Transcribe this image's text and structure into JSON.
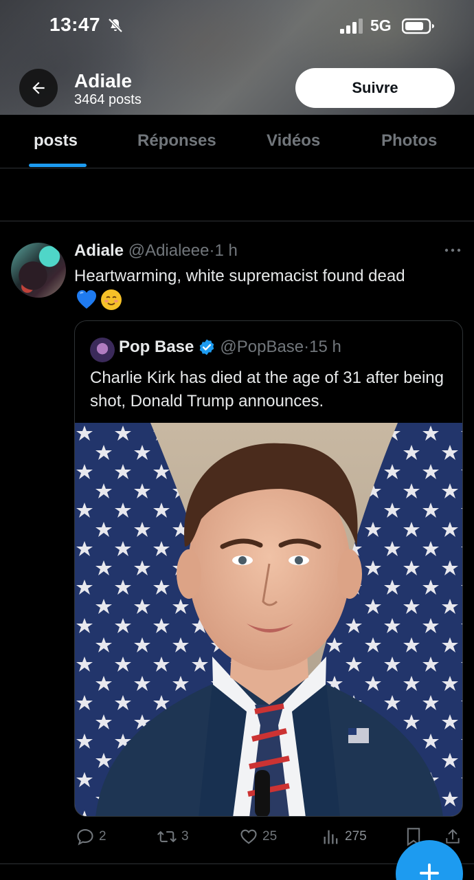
{
  "status_bar": {
    "time": "13:47",
    "network": "5G",
    "icons": [
      "bell-slash-icon",
      "signal-icon",
      "battery-icon"
    ]
  },
  "profile": {
    "name": "Adiale",
    "post_count": "3464 posts",
    "follow_label": "Suivre"
  },
  "tabs": [
    {
      "label": "posts",
      "active": true
    },
    {
      "label": "Réponses",
      "active": false
    },
    {
      "label": "Vidéos",
      "active": false
    },
    {
      "label": "Photos",
      "active": false
    }
  ],
  "tweet": {
    "author_name": "Adiale",
    "author_handle": "@Adialeee",
    "separator": "·",
    "time": "1 h",
    "text": "Heartwarming, white supremacist found dead",
    "emojis": [
      "blue-heart-emoji",
      "smiling-face-emoji"
    ],
    "quoted": {
      "author_name": "Pop Base",
      "verified": true,
      "author_handle": "@PopBase",
      "separator": "·",
      "time": "15 h",
      "text": "Charlie Kirk has died at the age of 31 after being shot, Donald Trump announces.",
      "image": "portrait of a man in a suit in front of American flags"
    },
    "actions": {
      "replies": "2",
      "reposts": "3",
      "likes": "25",
      "views": "275"
    }
  },
  "fab": {
    "icon": "plus-icon"
  },
  "colors": {
    "accent": "#1d9bf0",
    "background": "#000000",
    "text": "#e7e9ea",
    "muted": "#71767b",
    "border": "#2f3336"
  }
}
